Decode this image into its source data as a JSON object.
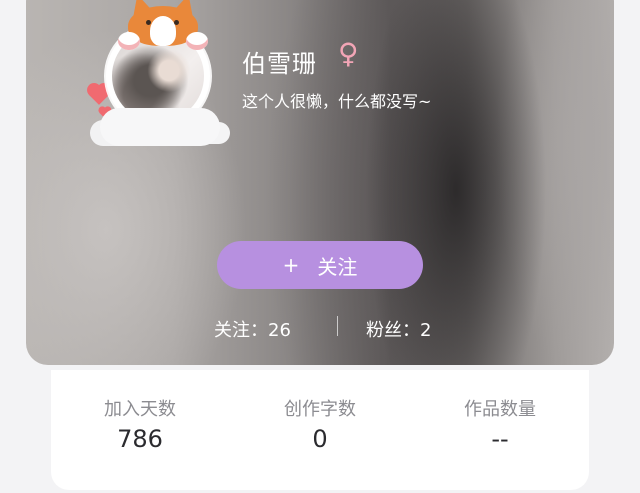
{
  "profile": {
    "name": "伯雪珊",
    "gender_symbol": "♀",
    "bio": "这个人很懒，什么都没写~",
    "follow_button": {
      "icon": "+",
      "label": "关注"
    },
    "following_label": "关注：26",
    "fans_label": "粉丝：2"
  },
  "summary": {
    "items": [
      {
        "label": "加入天数",
        "value": "786"
      },
      {
        "label": "创作字数",
        "value": "0"
      },
      {
        "label": "作品数量",
        "value": "--"
      }
    ]
  },
  "colors": {
    "follow_button": "#b790e0",
    "gender_symbol": "#f2a5b6",
    "label_gray": "#8c8c91",
    "value_dark": "#2b2b2f"
  },
  "icons": {
    "avatar_frame": "corgi-avatar-frame-icon",
    "gender": "female-symbol-icon",
    "follow": "plus-icon"
  }
}
